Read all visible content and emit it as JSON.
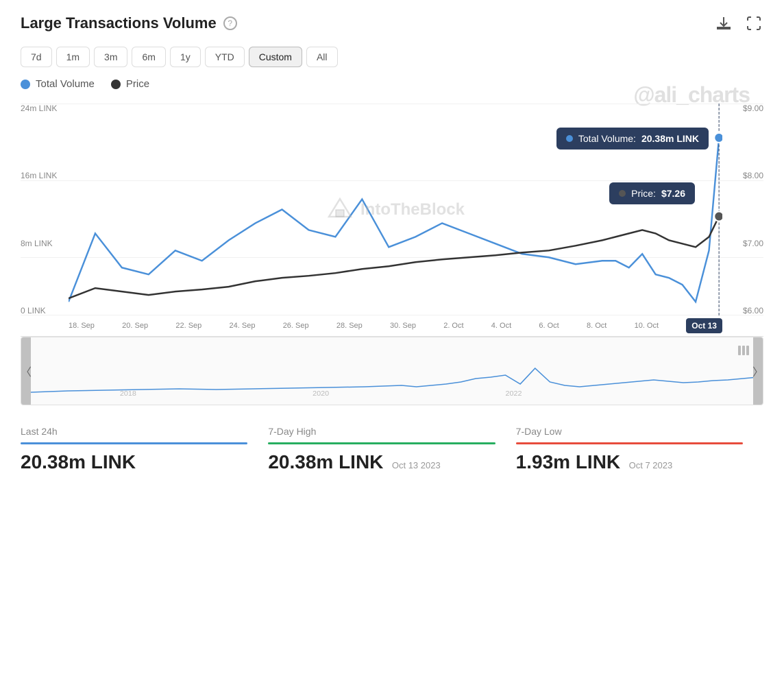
{
  "header": {
    "title": "Large Transactions Volume",
    "help_label": "?",
    "watermark": "@ali_charts"
  },
  "time_filters": [
    {
      "label": "7d",
      "active": false
    },
    {
      "label": "1m",
      "active": false
    },
    {
      "label": "3m",
      "active": false
    },
    {
      "label": "6m",
      "active": false
    },
    {
      "label": "1y",
      "active": false
    },
    {
      "label": "YTD",
      "active": false
    },
    {
      "label": "Custom",
      "active": true
    },
    {
      "label": "All",
      "active": false
    }
  ],
  "legend": [
    {
      "label": "Total Volume",
      "color": "blue"
    },
    {
      "label": "Price",
      "color": "dark"
    }
  ],
  "y_axis_left": [
    "24m LINK",
    "16m LINK",
    "8m LINK",
    "0 LINK"
  ],
  "y_axis_right": [
    "$9.00",
    "$8.00",
    "$7.00",
    "$6.00"
  ],
  "x_axis": [
    "18. Sep",
    "20. Sep",
    "22. Sep",
    "24. Sep",
    "26. Sep",
    "28. Sep",
    "30. Sep",
    "2. Oct",
    "4. Oct",
    "6. Oct",
    "8. Oct",
    "10. Oct"
  ],
  "tooltip_volume": {
    "label": "Total Volume:",
    "value": "20.38m LINK"
  },
  "tooltip_price": {
    "label": "Price:",
    "value": "$7.26"
  },
  "tooltip_date": "Oct 13",
  "navigator": {
    "years": [
      "2018",
      "2020",
      "2022"
    ]
  },
  "stats": [
    {
      "label": "Last 24h",
      "underline": "blue",
      "value": "20.38m LINK",
      "date": ""
    },
    {
      "label": "7-Day High",
      "underline": "green",
      "value": "20.38m LINK",
      "date": "Oct 13 2023"
    },
    {
      "label": "7-Day Low",
      "underline": "red",
      "value": "1.93m LINK",
      "date": "Oct 7 2023"
    }
  ]
}
